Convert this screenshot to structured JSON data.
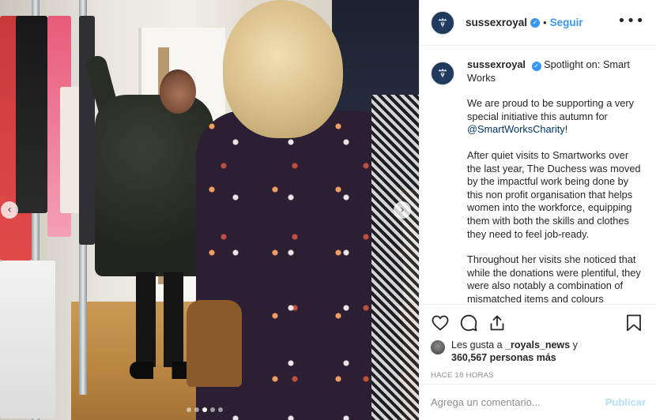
{
  "post": {
    "username": "sussexroyal",
    "follow_separator": "•",
    "follow_label": "Seguir",
    "more_glyph": "•••"
  },
  "caption": {
    "username": "sussexroyal",
    "title_text": "Spotlight on: Smart Works",
    "paragraph1_before": "We are proud to be supporting a very special initiative this autumn for ",
    "paragraph1_mention": "@SmartWorksCharity",
    "paragraph1_after": "!",
    "paragraph2": "After quiet visits to Smartworks over the last year, The Duchess was moved by the impactful work being done by this non profit organisation that helps women into the workforce, equipping them with both the skills and clothes they need to feel job-ready.",
    "paragraph3": "Throughout her visits she noticed that while the donations were plentiful, they were also notably a combination of mismatched items and colours"
  },
  "likes": {
    "prefix": "Les gusta a ",
    "user": "_royals_news",
    "middle": " y",
    "count": "360,567 personas más"
  },
  "timestamp": "Hace 18 horas",
  "comment": {
    "placeholder": "Agrega un comentario...",
    "publish_label": "Publicar"
  },
  "carousel": {
    "left_glyph": "‹",
    "right_glyph": "›",
    "slides": 5,
    "active_slide": 2
  },
  "icons": [
    "verified-badge-icon",
    "heart-icon",
    "comment-icon",
    "share-icon",
    "bookmark-icon",
    "crown-monogram-icon"
  ],
  "colors": {
    "link": "#3897f0",
    "mention": "#003569",
    "publish_disabled": "#b2dffc",
    "muted": "#8e8e8e",
    "avatar_bg": "#1f3a5c"
  }
}
